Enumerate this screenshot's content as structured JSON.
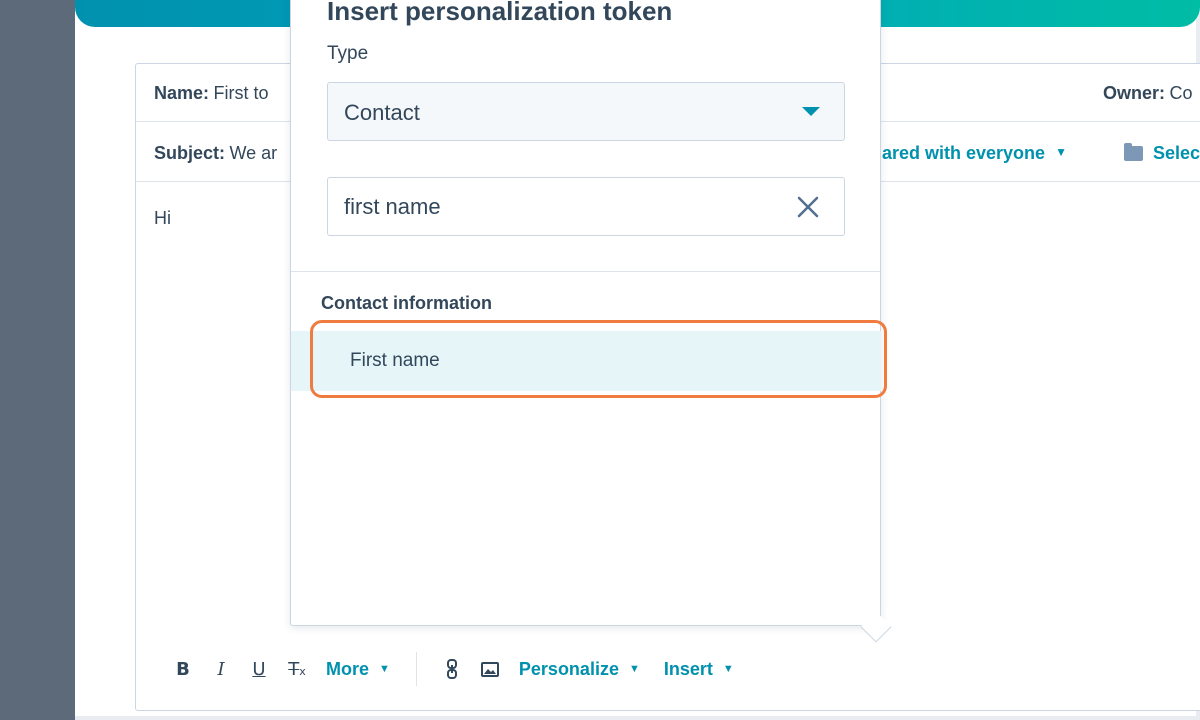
{
  "record": {
    "name_label": "Name:",
    "name_value": "First to",
    "owner_label": "Owner:",
    "owner_value": "Co",
    "subject_label": "Subject:",
    "subject_value": "We ar",
    "sharing": "hared with everyone",
    "folder": "Selec"
  },
  "editor": {
    "body_text": "Hi"
  },
  "toolbar": {
    "bold": "B",
    "italic": "I",
    "underline": "U",
    "clear_format": "T",
    "more": "More",
    "personalize": "Personalize",
    "insert": "Insert"
  },
  "popover": {
    "title": "Insert personalization token",
    "type_label": "Type",
    "type_selected": "Contact",
    "search_value": "first name",
    "section_heading": "Contact information",
    "results": [
      {
        "label": "First name"
      }
    ]
  },
  "colors": {
    "accent": "#0091ae",
    "text": "#33475b",
    "highlight": "#f07b3f",
    "selected_row": "#e5f5f8",
    "frame": "#5c6a79"
  }
}
